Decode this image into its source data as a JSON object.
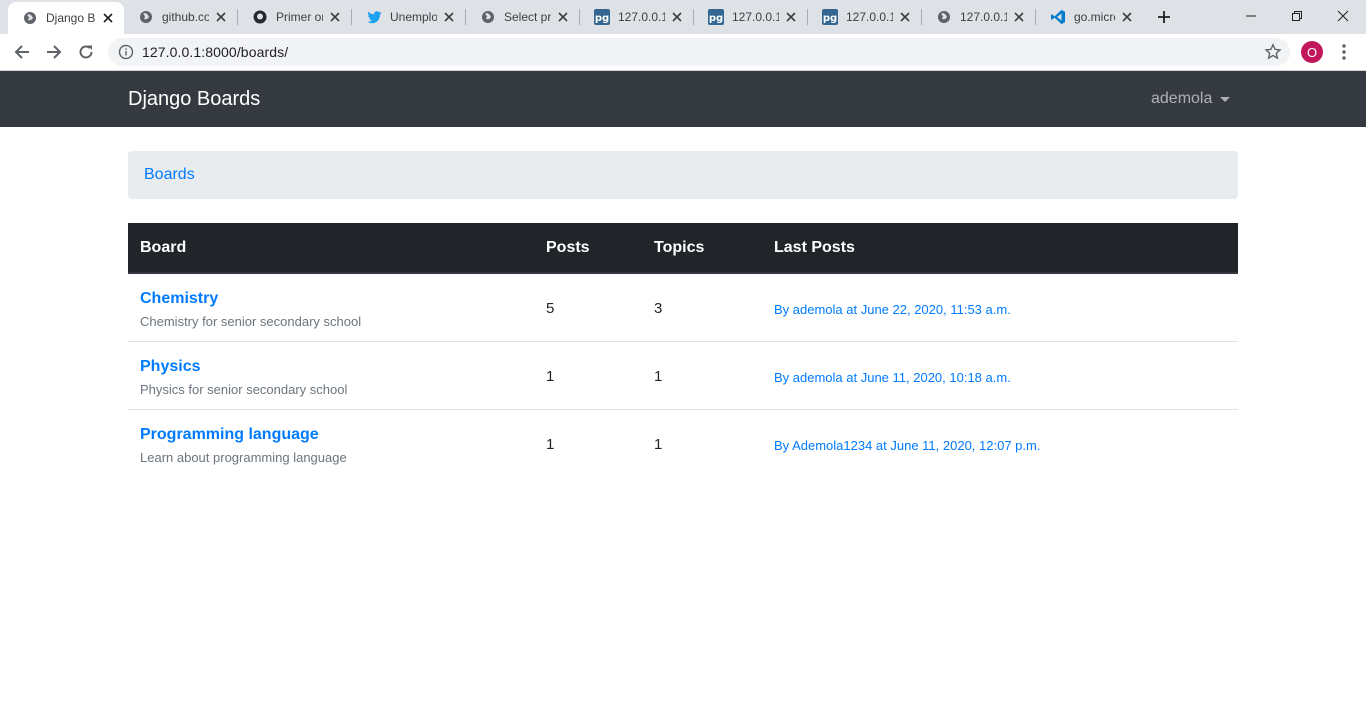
{
  "browser": {
    "tabs": [
      {
        "title": "Django B",
        "icon": "globe-icon",
        "active": true
      },
      {
        "title": "github.co",
        "icon": "globe-icon"
      },
      {
        "title": "Primer on",
        "icon": "github-icon"
      },
      {
        "title": "Unemplo",
        "icon": "twitter-icon"
      },
      {
        "title": "Select pr",
        "icon": "globe-icon"
      },
      {
        "title": "127.0.0.1",
        "icon": "pg-icon"
      },
      {
        "title": "127.0.0.1",
        "icon": "pg-icon"
      },
      {
        "title": "127.0.0.1",
        "icon": "pg-icon"
      },
      {
        "title": "127.0.0.1",
        "icon": "globe-icon"
      },
      {
        "title": "go.micro",
        "icon": "vscode-icon"
      }
    ],
    "url": "127.0.0.1:8000/boards/",
    "profile_initial": "O"
  },
  "navbar": {
    "brand": "Django Boards",
    "user": "ademola"
  },
  "breadcrumb": {
    "item": "Boards"
  },
  "table": {
    "headers": {
      "board": "Board",
      "posts": "Posts",
      "topics": "Topics",
      "last_posts": "Last Posts"
    },
    "rows": [
      {
        "name": "Chemistry",
        "description": "Chemistry for senior secondary school",
        "posts": "5",
        "topics": "3",
        "last_post": "By ademola at June 22, 2020, 11:53 a.m."
      },
      {
        "name": "Physics",
        "description": "Physics for senior secondary school",
        "posts": "1",
        "topics": "1",
        "last_post": "By ademola at June 11, 2020, 10:18 a.m."
      },
      {
        "name": "Programming language",
        "description": "Learn about programming language",
        "posts": "1",
        "topics": "1",
        "last_post": "By Ademola1234 at June 11, 2020, 12:07 p.m."
      }
    ]
  },
  "colors": {
    "navbar_bg": "#343a40",
    "link": "#007bff",
    "table_head_bg": "#212529",
    "breadcrumb_bg": "#e9ecef"
  }
}
